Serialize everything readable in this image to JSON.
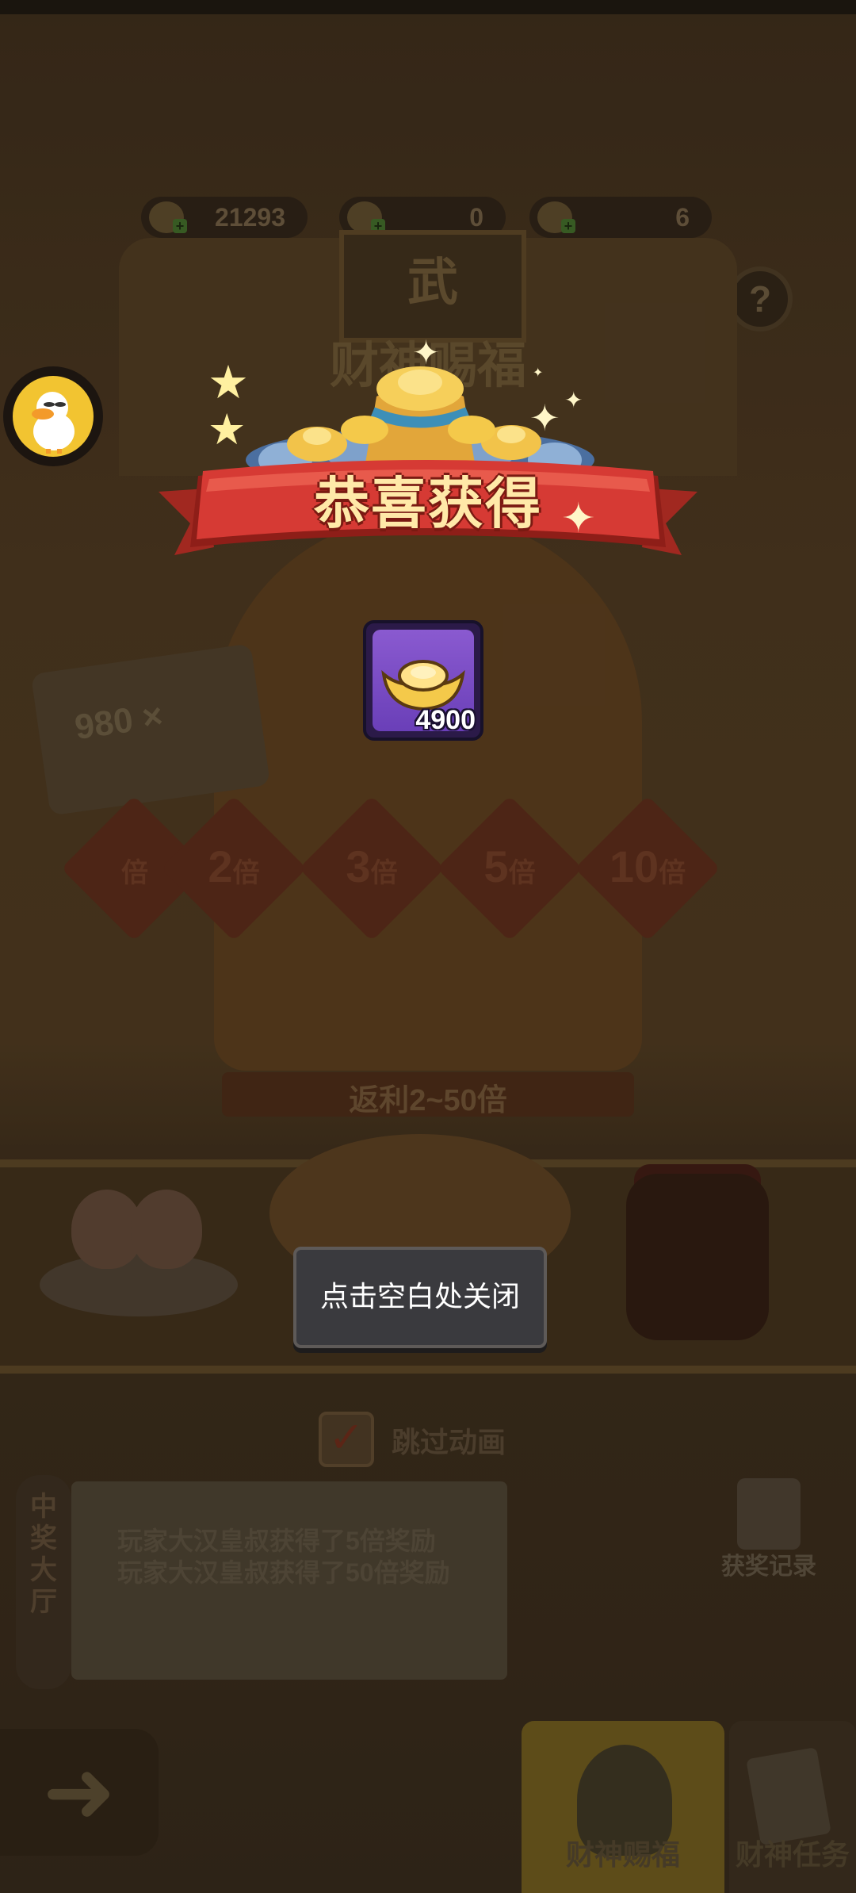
{
  "resources": [
    {
      "name": "gold-ingot",
      "value": "21293"
    },
    {
      "name": "leaf",
      "value": "0"
    },
    {
      "name": "ticket",
      "value": "6"
    }
  ],
  "help_label": "?",
  "shrine": {
    "sign": "武",
    "title": "财神赐福",
    "coin_plate": "980 ×",
    "multipliers": [
      {
        "num": "",
        "unit": "倍"
      },
      {
        "num": "2",
        "unit": "倍"
      },
      {
        "num": "3",
        "unit": "倍"
      },
      {
        "num": "5",
        "unit": "倍"
      },
      {
        "num": "10",
        "unit": "倍"
      }
    ],
    "rebate": "返利2~50倍"
  },
  "skip_animation": {
    "label": "跳过动画",
    "checked": true
  },
  "hall": {
    "label": "中奖大厅",
    "news": [
      "玩家大汉皇叔获得了5倍奖励",
      "玩家大汉皇叔获得了50倍奖励"
    ]
  },
  "records_label": "获奖记录",
  "tabs": [
    {
      "label": "财神赐福",
      "active": true
    },
    {
      "label": "财神任务",
      "active": false
    }
  ],
  "reward_popup": {
    "title": "恭喜获得",
    "item": {
      "name": "gold-ingot",
      "count": "4900"
    },
    "close_tip": "点击空白处关闭"
  },
  "colors": {
    "ribbon_red": "#d63a34",
    "item_purple": "#7a4cc6",
    "gold": "#f4c94a"
  }
}
